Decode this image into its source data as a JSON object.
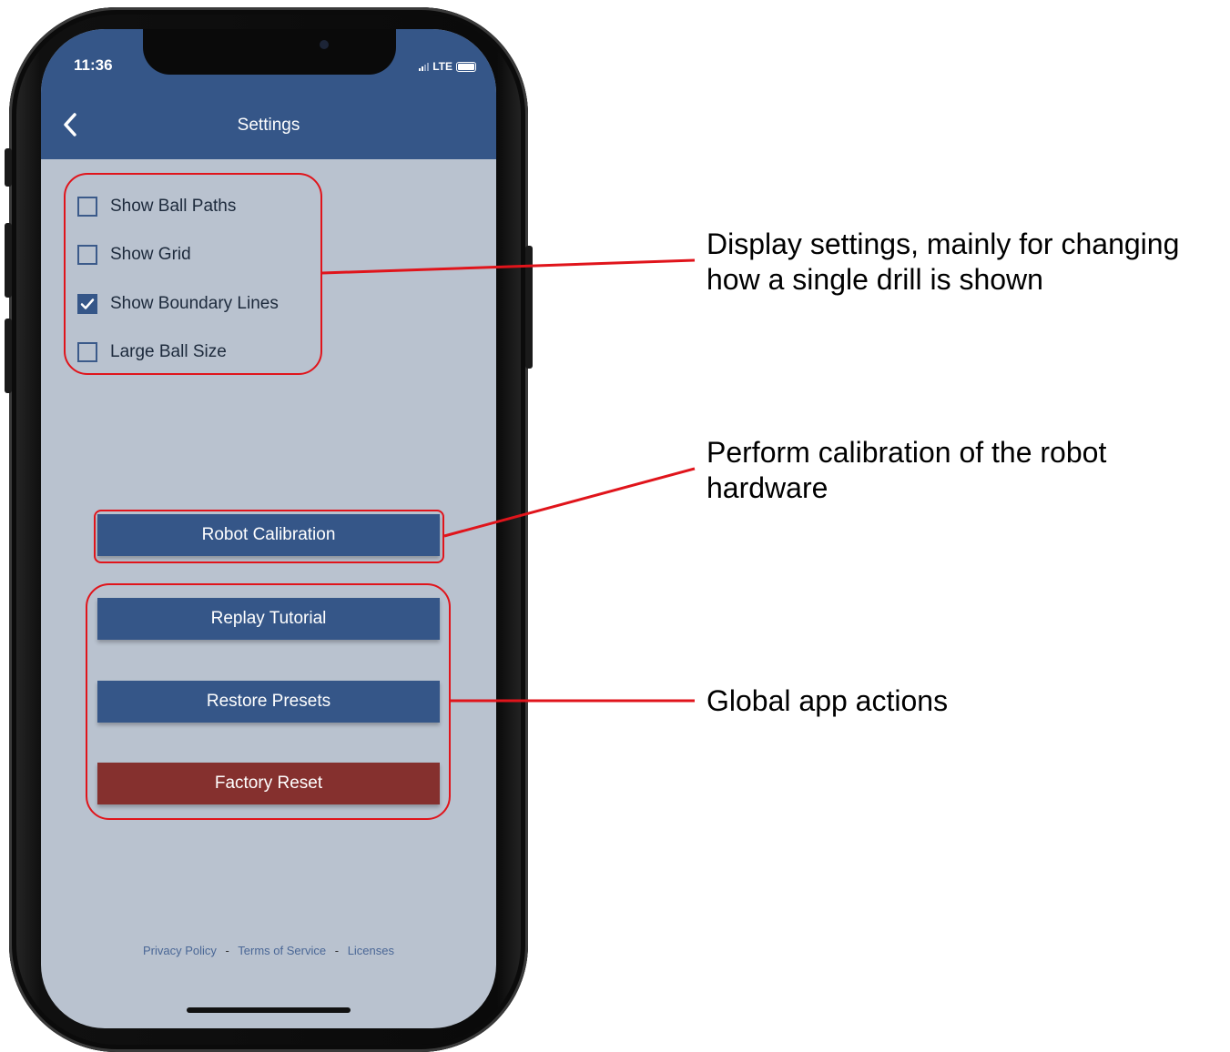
{
  "status_bar": {
    "time": "11:36",
    "network": "LTE"
  },
  "header": {
    "title": "Settings",
    "back_icon": "chevron-left-icon"
  },
  "display_settings": [
    {
      "label": "Show Ball Paths",
      "checked": false
    },
    {
      "label": "Show Grid",
      "checked": false
    },
    {
      "label": "Show Boundary Lines",
      "checked": true
    },
    {
      "label": "Large Ball Size",
      "checked": false
    }
  ],
  "buttons": {
    "robot_calibration": "Robot Calibration",
    "replay_tutorial": "Replay Tutorial",
    "restore_presets": "Restore Presets",
    "factory_reset": "Factory Reset"
  },
  "footer": {
    "privacy": "Privacy Policy",
    "separator": "-",
    "terms": "Terms of Service",
    "licenses": "Licenses"
  },
  "annotations": {
    "display": "Display settings, mainly for changing how a single drill is shown",
    "calibration": "Perform calibration of the robot hardware",
    "global": "Global app actions"
  },
  "colors": {
    "primary": "#355688",
    "danger": "#85302e",
    "screen_bg": "#b9c2cf",
    "annotation": "#e0141b"
  }
}
